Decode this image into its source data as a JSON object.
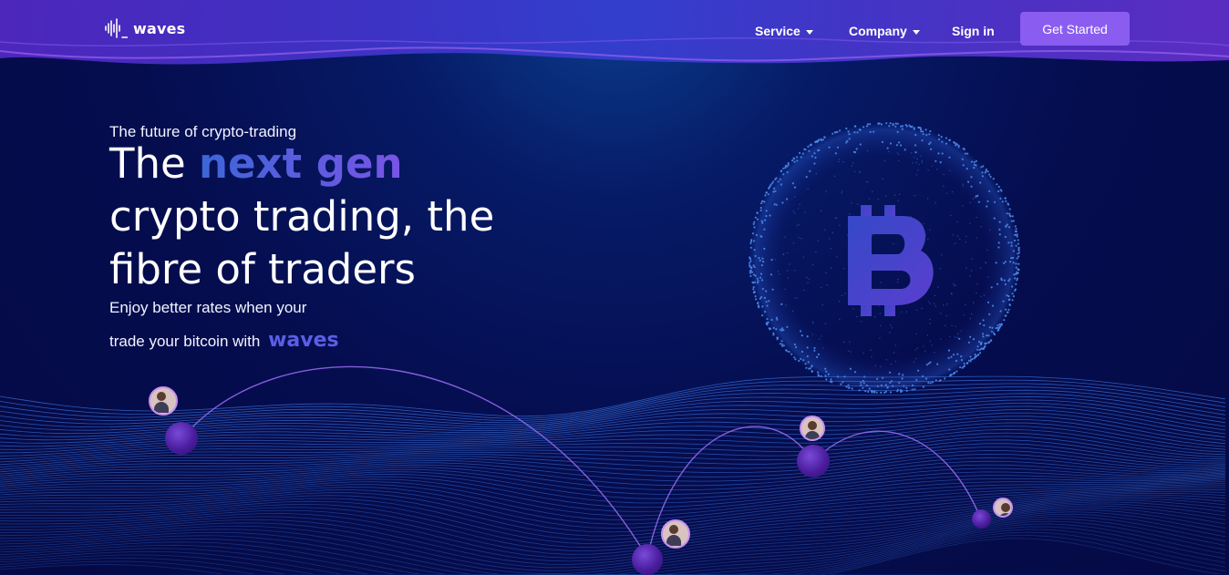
{
  "brand": {
    "name": "waves"
  },
  "nav": {
    "items": [
      {
        "label": "Service",
        "has_dropdown": true
      },
      {
        "label": "Company",
        "has_dropdown": true
      },
      {
        "label": "Sign in",
        "has_dropdown": false
      }
    ],
    "cta_label": "Get Started"
  },
  "hero": {
    "eyebrow": "The future of crypto-trading",
    "headline_prefix": "The ",
    "headline_highlight": "next gen",
    "headline_line2": "crypto trading, the",
    "headline_line3": "fibre of traders",
    "sub_line1": "Enjoy better rates when your",
    "sub_line2": "trade your bitcoin with",
    "sub_brand": "waves"
  },
  "colors": {
    "accent": "#8a5cf0",
    "highlight_from": "#3c66d8",
    "highlight_to": "#7a54e6",
    "background": "#050d4f"
  },
  "icons": [
    "waves-logo-icon",
    "chevron-down-icon",
    "bitcoin-icon",
    "globe-particles-icon",
    "avatar-pin-icon"
  ]
}
